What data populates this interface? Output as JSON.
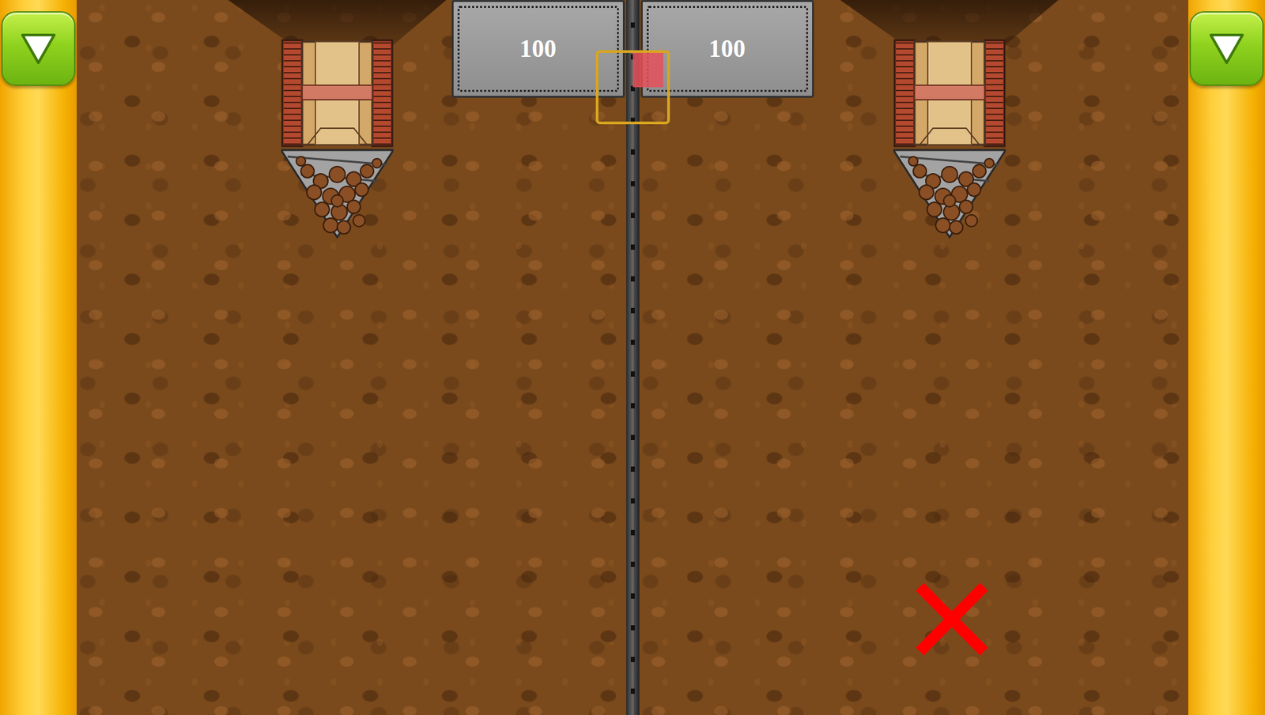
{
  "players": [
    {
      "side": "left",
      "score": "100",
      "marked": false
    },
    {
      "side": "right",
      "score": "100",
      "marked": true
    }
  ],
  "center_indicator": {
    "level": 0.45
  }
}
